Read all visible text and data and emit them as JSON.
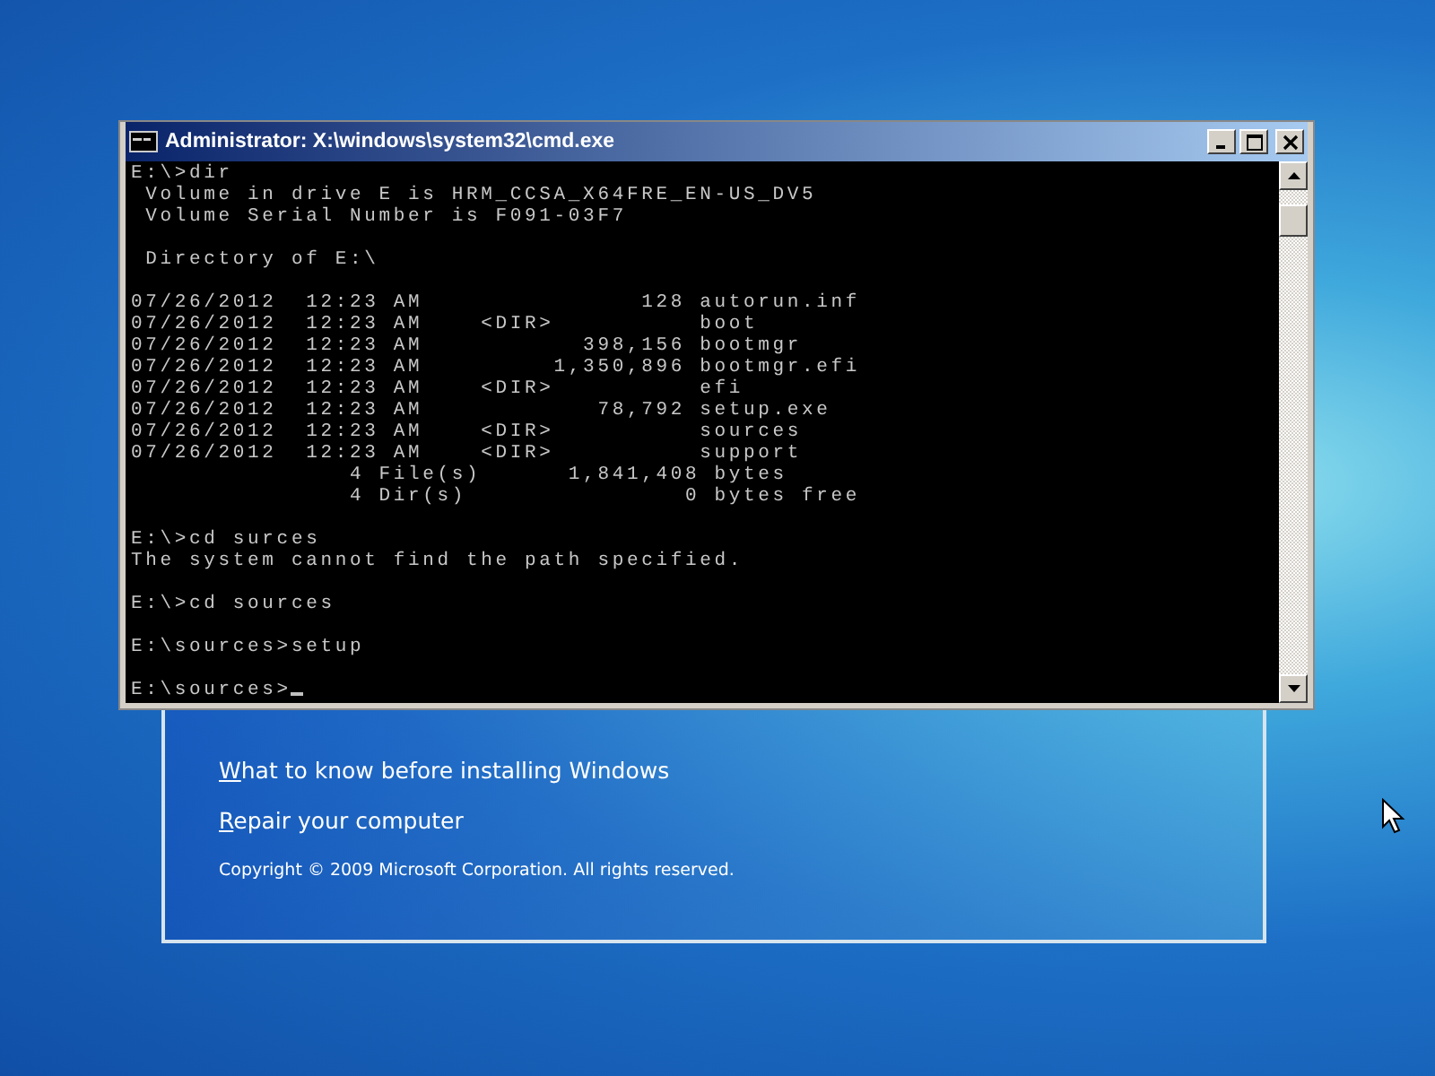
{
  "console_window": {
    "title": "Administrator: X:\\windows\\system32\\cmd.exe",
    "blocks": [
      [
        "E:\\>dir",
        " Volume in drive E is HRM_CCSA_X64FRE_EN-US_DV5",
        " Volume Serial Number is F091-03F7"
      ],
      [
        " Directory of E:\\"
      ],
      [
        "07/26/2012  12:23 AM               128 autorun.inf",
        "07/26/2012  12:23 AM    <DIR>          boot",
        "07/26/2012  12:23 AM           398,156 bootmgr",
        "07/26/2012  12:23 AM         1,350,896 bootmgr.efi",
        "07/26/2012  12:23 AM    <DIR>          efi",
        "07/26/2012  12:23 AM            78,792 setup.exe",
        "07/26/2012  12:23 AM    <DIR>          sources",
        "07/26/2012  12:23 AM    <DIR>          support",
        "               4 File(s)      1,841,408 bytes",
        "               4 Dir(s)               0 bytes free"
      ],
      [
        "E:\\>cd surces",
        "The system cannot find the path specified."
      ],
      [
        "E:\\>cd sources"
      ],
      [
        "E:\\sources>setup"
      ],
      [
        "E:\\sources>"
      ]
    ],
    "cursor_visible": true
  },
  "setup_window": {
    "links": [
      {
        "label": "What to know before installing Windows",
        "access_key_underlined": true
      },
      {
        "label": "Repair your computer",
        "access_key_underlined": true
      }
    ],
    "copyright": "Copyright © 2009 Microsoft Corporation. All rights reserved."
  }
}
